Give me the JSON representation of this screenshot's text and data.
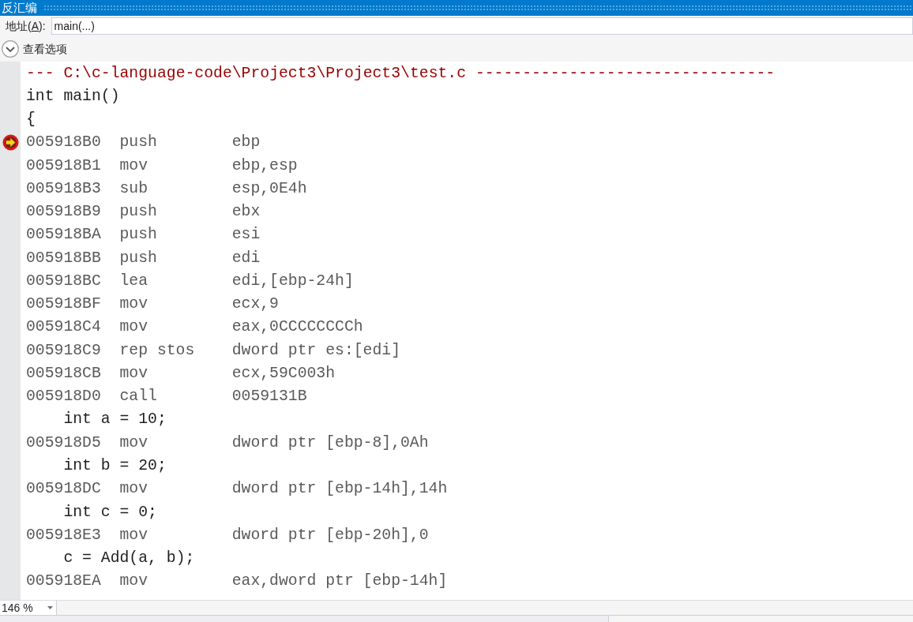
{
  "window": {
    "title": "反汇编"
  },
  "address_bar": {
    "label_before": "地址(",
    "access_key": "A",
    "label_after": "):",
    "value": "main(...)"
  },
  "view_options": {
    "label": "查看选项",
    "expanded": false
  },
  "disassembly": {
    "lines": [
      {
        "kind": "header",
        "text": "--- C:\\c-language-code\\Project3\\Project3\\test.c --------------------------------"
      },
      {
        "kind": "source",
        "text": "int main()"
      },
      {
        "kind": "source",
        "text": "{"
      },
      {
        "kind": "instruction",
        "address": "005918B0",
        "mnemonic": "push",
        "operands": "ebp",
        "current": true
      },
      {
        "kind": "instruction",
        "address": "005918B1",
        "mnemonic": "mov",
        "operands": "ebp,esp",
        "current": false
      },
      {
        "kind": "instruction",
        "address": "005918B3",
        "mnemonic": "sub",
        "operands": "esp,0E4h",
        "current": false
      },
      {
        "kind": "instruction",
        "address": "005918B9",
        "mnemonic": "push",
        "operands": "ebx",
        "current": false
      },
      {
        "kind": "instruction",
        "address": "005918BA",
        "mnemonic": "push",
        "operands": "esi",
        "current": false
      },
      {
        "kind": "instruction",
        "address": "005918BB",
        "mnemonic": "push",
        "operands": "edi",
        "current": false
      },
      {
        "kind": "instruction",
        "address": "005918BC",
        "mnemonic": "lea",
        "operands": "edi,[ebp-24h]",
        "current": false
      },
      {
        "kind": "instruction",
        "address": "005918BF",
        "mnemonic": "mov",
        "operands": "ecx,9",
        "current": false
      },
      {
        "kind": "instruction",
        "address": "005918C4",
        "mnemonic": "mov",
        "operands": "eax,0CCCCCCCCh",
        "current": false
      },
      {
        "kind": "instruction",
        "address": "005918C9",
        "mnemonic": "rep stos",
        "operands": "dword ptr es:[edi]",
        "current": false
      },
      {
        "kind": "instruction",
        "address": "005918CB",
        "mnemonic": "mov",
        "operands": "ecx,59C003h",
        "current": false
      },
      {
        "kind": "instruction",
        "address": "005918D0",
        "mnemonic": "call",
        "operands": "0059131B",
        "current": false
      },
      {
        "kind": "source",
        "text": "    int a = 10;"
      },
      {
        "kind": "instruction",
        "address": "005918D5",
        "mnemonic": "mov",
        "operands": "dword ptr [ebp-8],0Ah",
        "current": false
      },
      {
        "kind": "source",
        "text": "    int b = 20;"
      },
      {
        "kind": "instruction",
        "address": "005918DC",
        "mnemonic": "mov",
        "operands": "dword ptr [ebp-14h],14h",
        "current": false
      },
      {
        "kind": "source",
        "text": "    int c = 0;"
      },
      {
        "kind": "instruction",
        "address": "005918E3",
        "mnemonic": "mov",
        "operands": "dword ptr [ebp-20h],0",
        "current": false
      },
      {
        "kind": "source",
        "text": "    c = Add(a, b);"
      },
      {
        "kind": "instruction",
        "address": "005918EA",
        "mnemonic": "mov",
        "operands": "eax,dword ptr [ebp-14h]",
        "current": false
      }
    ]
  },
  "zoom_box": {
    "value": "146 %"
  }
}
